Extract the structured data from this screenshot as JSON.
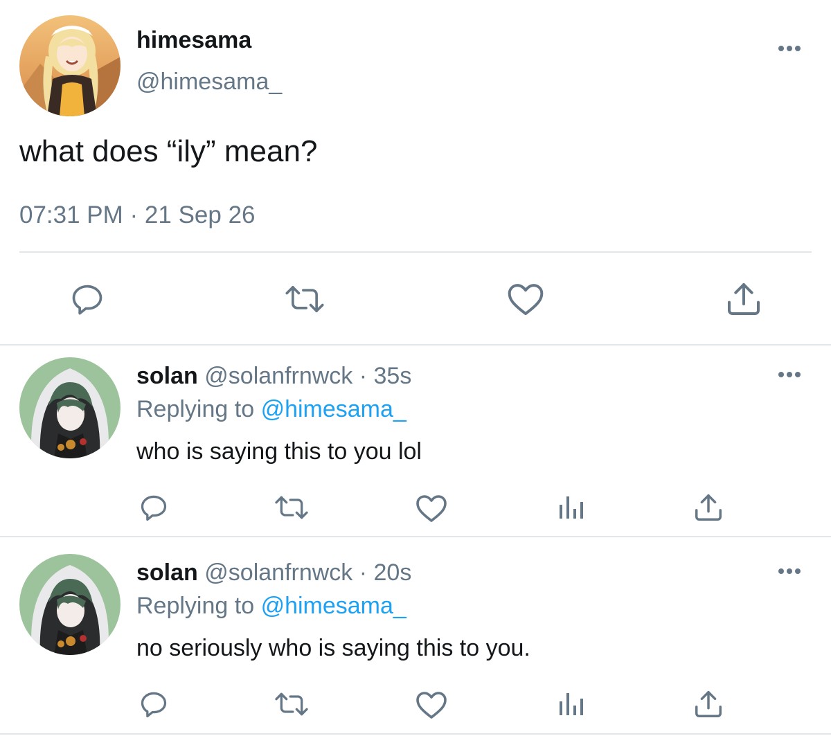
{
  "main_tweet": {
    "display_name": "himesama",
    "handle": "@himesama_",
    "text": "what does “ily” mean?",
    "timestamp": "07:31 PM · 21 Sep 26",
    "avatar_icon": "avatar-himesama",
    "actions": [
      "reply-icon",
      "retweet-icon",
      "like-icon",
      "share-icon"
    ]
  },
  "replies": [
    {
      "display_name": "solan",
      "handle_time": "@solanfrnwck · 35s",
      "replying_prefix": "Replying to",
      "replying_handle": "@himesama_",
      "text": "who is saying this to you lol",
      "avatar_icon": "avatar-solan",
      "actions": [
        "reply-icon",
        "retweet-icon",
        "like-icon",
        "analytics-icon",
        "share-icon"
      ]
    },
    {
      "display_name": "solan",
      "handle_time": "@solanfrnwck · 20s",
      "replying_prefix": "Replying to",
      "replying_handle": "@himesama_",
      "text": "no seriously who is saying this to you.",
      "avatar_icon": "avatar-solan",
      "actions": [
        "reply-icon",
        "retweet-icon",
        "like-icon",
        "analytics-icon",
        "share-icon"
      ]
    }
  ],
  "colors": {
    "text": "#14171a",
    "secondary": "#657786",
    "link": "#1da1f2",
    "divider": "#e1e8ed"
  }
}
